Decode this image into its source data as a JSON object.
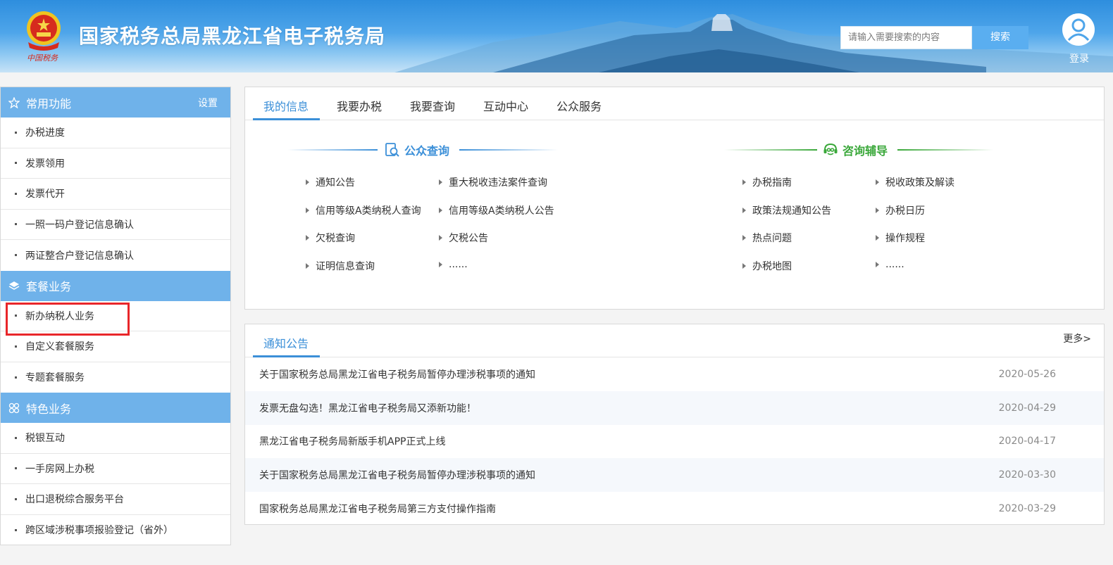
{
  "header": {
    "site_title": "国家税务总局黑龙江省电子税务局",
    "emblem_caption": "中国税务",
    "search_placeholder": "请输入需要搜索的内容",
    "search_button": "搜索",
    "login_label": "登录"
  },
  "sidebar": {
    "sections": [
      {
        "title": "常用功能",
        "icon": "star-icon",
        "setting": "设置",
        "items": [
          "办税进度",
          "发票领用",
          "发票代开",
          "一照一码户登记信息确认",
          "两证整合户登记信息确认"
        ]
      },
      {
        "title": "套餐业务",
        "icon": "layers-icon",
        "items": [
          "新办纳税人业务",
          "自定义套餐服务",
          "专题套餐服务"
        ]
      },
      {
        "title": "特色业务",
        "icon": "grid-icon",
        "items": [
          "税银互动",
          "一手房网上办税",
          "出口退税综合服务平台",
          "跨区域涉税事项报验登记（省外）"
        ]
      }
    ]
  },
  "info_panel": {
    "tabs": [
      "我的信息",
      "我要办税",
      "我要查询",
      "互动中心",
      "公众服务"
    ],
    "active_tab": 0,
    "public_query": {
      "title": "公众查询",
      "links": [
        "通知公告",
        "重大税收违法案件查询",
        "信用等级A类纳税人查询",
        "信用等级A类纳税人公告",
        "欠税查询",
        "欠税公告",
        "证明信息查询",
        "......"
      ]
    },
    "consulting": {
      "title": "咨询辅导",
      "links": [
        "办税指南",
        "税收政策及解读",
        "政策法规通知公告",
        "办税日历",
        "热点问题",
        "操作规程",
        "办税地图",
        "......"
      ]
    }
  },
  "notice_panel": {
    "tab": "通知公告",
    "more": "更多>",
    "rows": [
      {
        "title": "关于国家税务总局黑龙江省电子税务局暂停办理涉税事项的通知",
        "date": "2020-05-26"
      },
      {
        "title": "发票无盘勾选！黑龙江省电子税务局又添新功能！",
        "date": "2020-04-29"
      },
      {
        "title": "黑龙江省电子税务局新版手机APP正式上线",
        "date": "2020-04-17"
      },
      {
        "title": "关于国家税务总局黑龙江省电子税务局暂停办理涉税事项的通知",
        "date": "2020-03-30"
      },
      {
        "title": "国家税务总局黑龙江省电子税务局第三方支付操作指南",
        "date": "2020-03-29"
      }
    ]
  },
  "colors": {
    "accent": "#3b8fd8",
    "sidebar_header": "#6fb2ea",
    "consult_green": "#3aa83a",
    "highlight": "#e8262a"
  }
}
